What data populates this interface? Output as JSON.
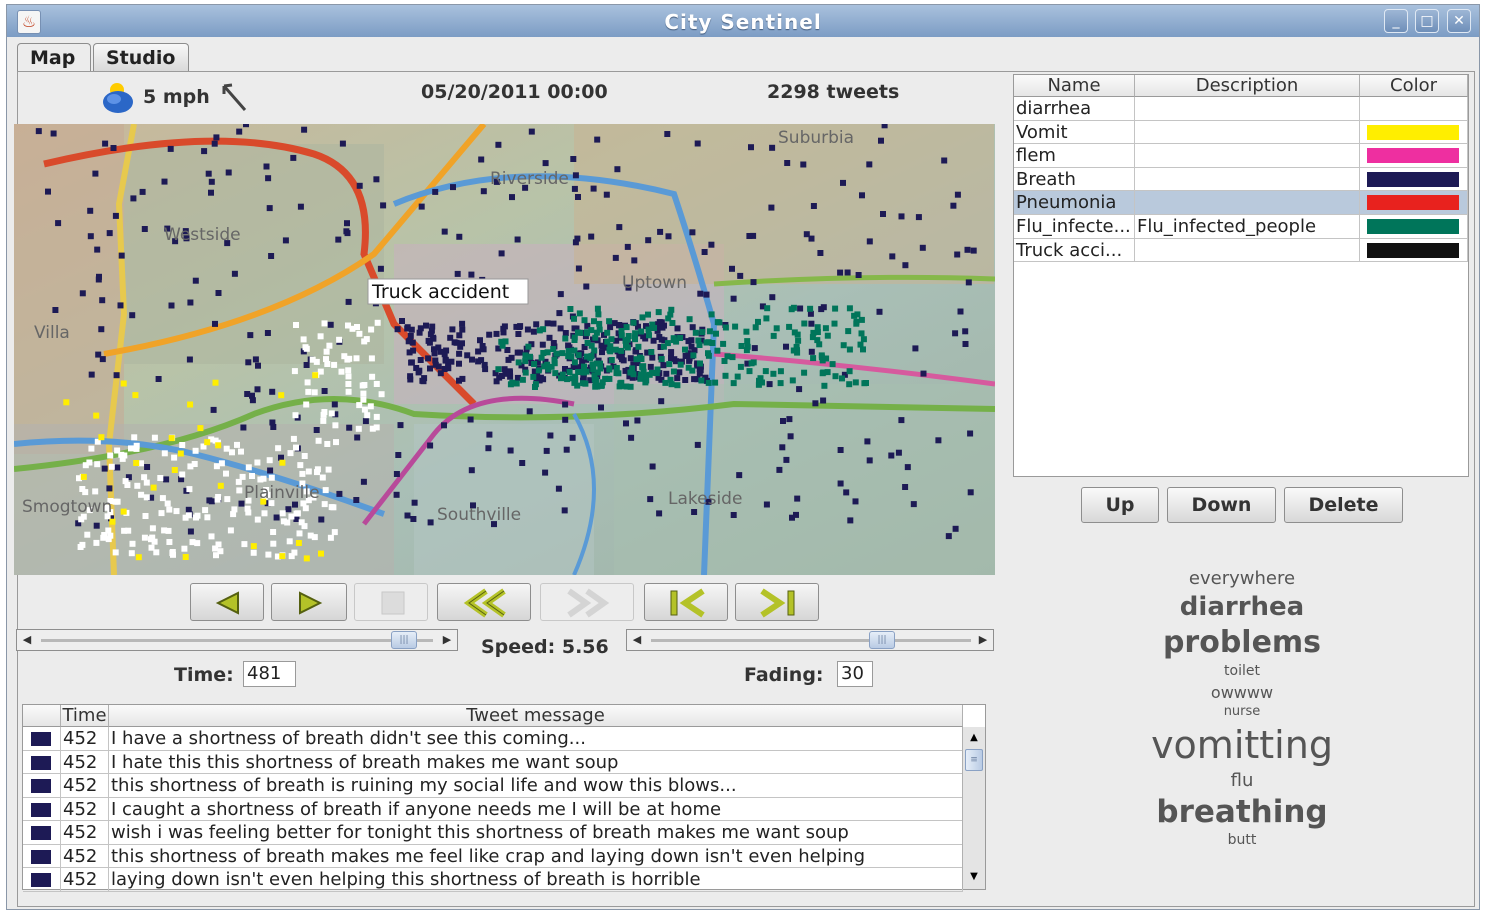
{
  "window": {
    "title": "City Sentinel",
    "buttons": [
      "_",
      "□",
      "✕"
    ]
  },
  "tabs": [
    {
      "label": "Map",
      "active": true
    },
    {
      "label": "Studio",
      "active": false
    }
  ],
  "status": {
    "wind": "5 mph",
    "datetime": "05/20/2011 00:00",
    "tweet_count": "2298 tweets"
  },
  "map": {
    "annotation": "Truck accident",
    "places": [
      "Suburbia",
      "Riverside",
      "Westside",
      "Uptown",
      "Villa",
      "Smogtown",
      "Plainville",
      "Southville",
      "Lakeside"
    ]
  },
  "playback": {
    "buttons": [
      "back",
      "play",
      "stop",
      "rewind",
      "fast-forward",
      "to-start",
      "to-end"
    ]
  },
  "time_slider": {
    "label": "Time:",
    "value": "481"
  },
  "speed": {
    "text": "Speed: 5.56"
  },
  "fading": {
    "label": "Fading:",
    "value": "30"
  },
  "topics_table": {
    "headers": [
      "Name",
      "Description",
      "Color"
    ],
    "rows": [
      {
        "name": "diarrhea",
        "description": "",
        "color": ""
      },
      {
        "name": "Vomit",
        "description": "",
        "color": "#ffee00"
      },
      {
        "name": "flem",
        "description": "",
        "color": "#ee2fa0"
      },
      {
        "name": "Breath",
        "description": "",
        "color": "#1d1a55"
      },
      {
        "name": "Pneumonia",
        "description": "",
        "color": "#e8221e",
        "selected": true
      },
      {
        "name": "Flu_infecte...",
        "description": "Flu_infected_people",
        "color": "#00755a"
      },
      {
        "name": "Truck acci...",
        "description": "",
        "color": "#111111"
      }
    ]
  },
  "table_buttons": {
    "up": "Up",
    "down": "Down",
    "delete": "Delete"
  },
  "word_cloud": [
    {
      "word": "everywhere",
      "size": 18,
      "weight": "normal"
    },
    {
      "word": "diarrhea",
      "size": 26,
      "weight": "bold"
    },
    {
      "word": "problems",
      "size": 30,
      "weight": "bold"
    },
    {
      "word": "toilet",
      "size": 14,
      "weight": "normal"
    },
    {
      "word": "owwww",
      "size": 16,
      "weight": "normal"
    },
    {
      "word": "nurse",
      "size": 13,
      "weight": "normal"
    },
    {
      "word": "vomitting",
      "size": 38,
      "weight": "normal"
    },
    {
      "word": "flu",
      "size": 18,
      "weight": "normal"
    },
    {
      "word": "breathing",
      "size": 31,
      "weight": "bold"
    },
    {
      "word": "butt",
      "size": 14,
      "weight": "normal"
    }
  ],
  "tweets_table": {
    "headers": [
      "",
      "Time",
      "Tweet message"
    ],
    "swatch_color": "#1d1a55",
    "rows": [
      {
        "time": "452",
        "message": "I have a shortness of breath didn't see this coming..."
      },
      {
        "time": "452",
        "message": "I hate this this shortness of breath makes me want soup"
      },
      {
        "time": "452",
        "message": "this shortness of breath is ruining my social life and wow this blows..."
      },
      {
        "time": "452",
        "message": "I caught a shortness of breath if anyone needs me I will be at home"
      },
      {
        "time": "452",
        "message": "wish i was feeling better for tonight this shortness of breath makes me want soup"
      },
      {
        "time": "452",
        "message": "this shortness of breath makes me feel like crap and laying down isn't even helping"
      },
      {
        "time": "452",
        "message": "laying down isn't even helping this shortness of breath is horrible"
      }
    ]
  }
}
